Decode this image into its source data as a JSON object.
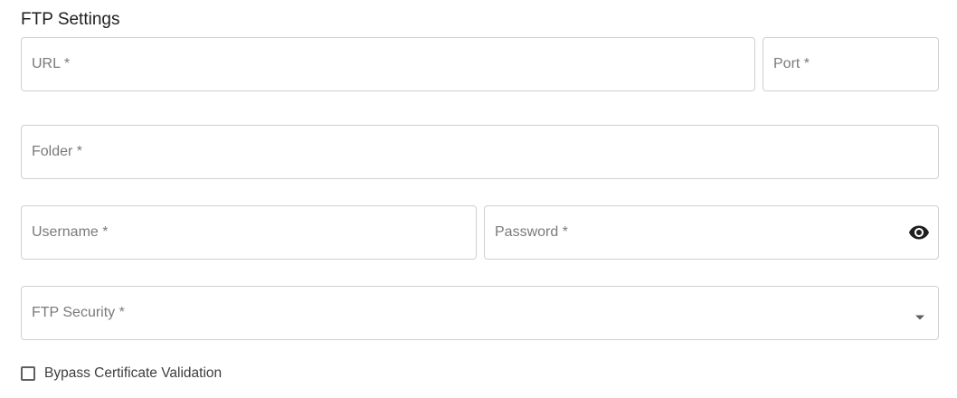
{
  "section": {
    "title": "FTP Settings"
  },
  "fields": {
    "url": {
      "placeholder": "URL *",
      "value": ""
    },
    "port": {
      "placeholder": "Port *",
      "value": ""
    },
    "folder": {
      "placeholder": "Folder *",
      "value": ""
    },
    "username": {
      "placeholder": "Username *",
      "value": ""
    },
    "password": {
      "placeholder": "Password *",
      "value": "",
      "toggle_icon": "eye-icon"
    },
    "ftp_security": {
      "placeholder": "FTP Security *",
      "selected": "",
      "dropdown_icon": "caret-down-icon"
    }
  },
  "bypass_certificate": {
    "label": "Bypass Certificate Validation",
    "checked": false
  },
  "colors": {
    "border": "#d0d0d0",
    "placeholder": "#7a7a7a",
    "icon": "#1f1f1f"
  }
}
